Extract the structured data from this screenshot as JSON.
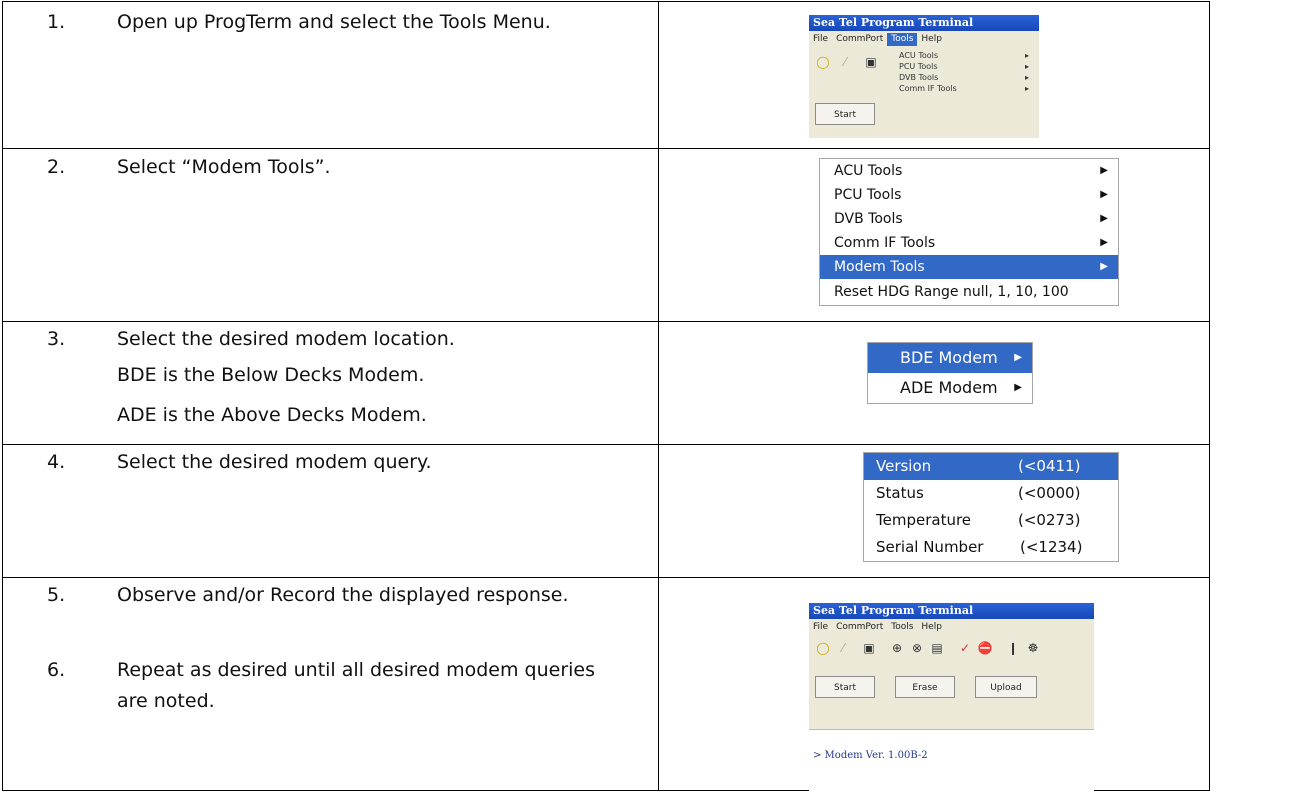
{
  "steps": {
    "s1": {
      "num": "1.",
      "text": "Open up ProgTerm and select the Tools Menu."
    },
    "s2": {
      "num": "2.",
      "text": "Select “Modem Tools”."
    },
    "s3": {
      "num": "3.",
      "text": "Select the desired modem location.",
      "line2": "BDE is the Below Decks Modem.",
      "line3": "ADE is the Above Decks Modem."
    },
    "s4": {
      "num": "4.",
      "text": "Select the desired modem query."
    },
    "s5": {
      "num": "5.",
      "text": "Observe and/or Record the displayed response."
    },
    "s6": {
      "num": "6.",
      "text": "Repeat as desired until all desired modem queries are noted."
    }
  },
  "shot1": {
    "title": "Sea Tel Program Terminal",
    "menus": [
      "File",
      "CommPort",
      "Tools",
      "Help"
    ],
    "start": "Start",
    "tools_items": [
      "ACU Tools",
      "PCU Tools",
      "DVB Tools",
      "Comm IF Tools"
    ]
  },
  "shot2": {
    "items": [
      "ACU Tools",
      "PCU Tools",
      "DVB Tools",
      "Comm IF Tools",
      "Modem Tools",
      "Reset HDG Range null, 1, 10, 100"
    ],
    "selected_index": 4
  },
  "shot3": {
    "items": [
      "BDE Modem",
      "ADE Modem"
    ],
    "selected_index": 0
  },
  "shot4": {
    "items": [
      {
        "label": "Version",
        "value": "(<0411)"
      },
      {
        "label": "Status",
        "value": "(<0000)"
      },
      {
        "label": "Temperature",
        "value": "(<0273)"
      },
      {
        "label": "Serial Number",
        "value": "(<1234)"
      }
    ],
    "selected_index": 0
  },
  "shot5": {
    "title": "Sea Tel Program Terminal",
    "menus": [
      "File",
      "CommPort",
      "Tools",
      "Help"
    ],
    "buttons": [
      "Start",
      "Erase",
      "Upload"
    ],
    "output": "> Modem Ver. 1.00B-2"
  },
  "colors": {
    "menu_highlight": "#3369c6",
    "title_bar": "#2a62d6",
    "border": "#000000"
  }
}
